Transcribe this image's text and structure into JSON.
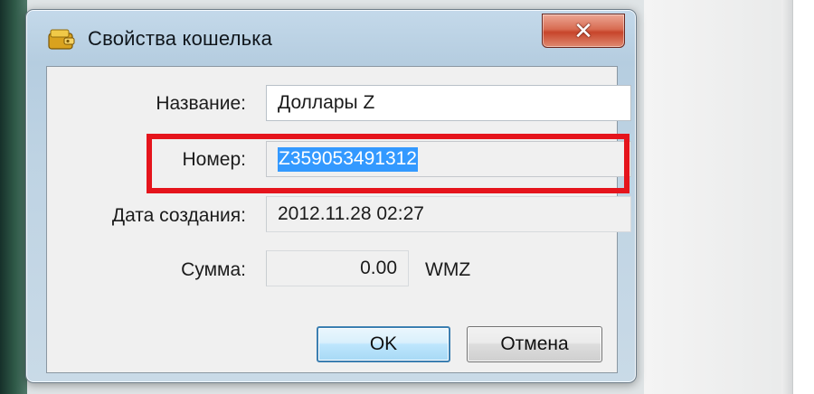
{
  "dialog": {
    "title": "Свойства кошелька",
    "close_glyph": "✕"
  },
  "fields": {
    "name_label": "Название:",
    "name_value": "Доллары Z",
    "number_label": "Номер:",
    "number_value": "Z359053491312",
    "created_label": "Дата создания:",
    "created_value": "2012.11.28 02:27",
    "amount_label": "Сумма:",
    "amount_value": "0.00",
    "amount_currency": "WMZ"
  },
  "buttons": {
    "ok_label": "OK",
    "cancel_label": "Отмена"
  },
  "colors": {
    "highlight": "#e5141c",
    "selection": "#3399ff"
  },
  "icons": {
    "title": "wallet-icon",
    "close": "close-icon"
  }
}
